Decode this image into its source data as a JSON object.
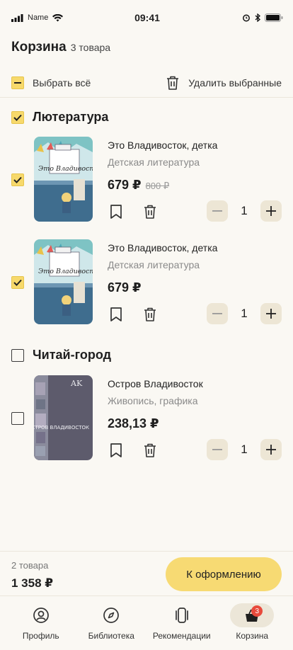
{
  "status_bar": {
    "carrier": "Name",
    "time": "09:41"
  },
  "header": {
    "title": "Корзина",
    "count": "3 товара"
  },
  "toolbar": {
    "select_all": "Выбрать всё",
    "delete_selected": "Удалить выбранные"
  },
  "stores": [
    {
      "name": "Лютература",
      "items": [
        {
          "title": "Это Владивосток, детка",
          "genre": "Детская литература",
          "price": "679 ₽",
          "old_price": "800 ₽",
          "qty": "1",
          "cover_title": "Это Владивосток, детка"
        },
        {
          "title": "Это Владивосток, детка",
          "genre": "Детская литература",
          "price": "679 ₽",
          "old_price": "",
          "qty": "1",
          "cover_title": "Это Владивосток, детка"
        }
      ]
    },
    {
      "name": "Читай-город",
      "items": [
        {
          "title": "Остров Владивосток",
          "genre": "Живопись, графика",
          "price": "238,13 ₽",
          "old_price": "",
          "qty": "1",
          "cover_title": "ОСТРОВ ВЛАДИВОСТОК"
        }
      ]
    }
  ],
  "footer": {
    "count": "2 товара",
    "total": "1 358 ₽",
    "checkout": "К оформлению"
  },
  "tabs": [
    {
      "label": "Профиль",
      "icon": "profile-icon"
    },
    {
      "label": "Библиотека",
      "icon": "compass-icon"
    },
    {
      "label": "Рекомендации",
      "icon": "cards-icon"
    },
    {
      "label": "Корзина",
      "icon": "basket-icon",
      "badge": "3"
    }
  ],
  "colors": {
    "accent": "#f7da73",
    "background": "#faf8f3",
    "badge": "#e84a3c"
  }
}
